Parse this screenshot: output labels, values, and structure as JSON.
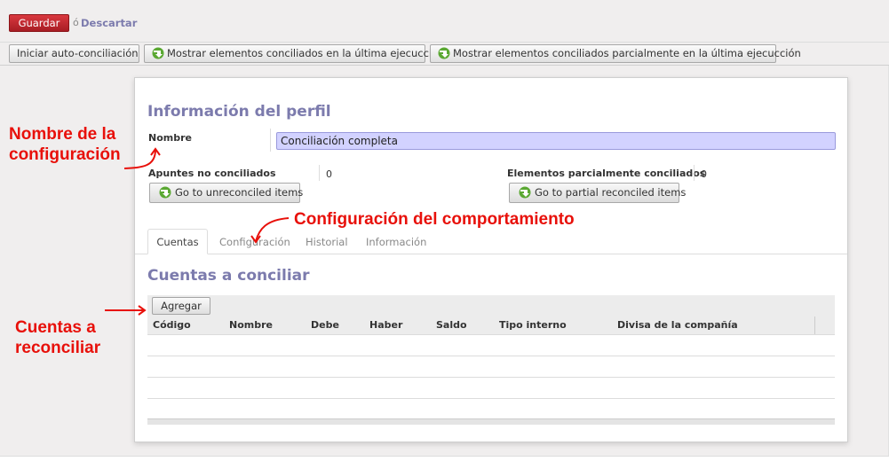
{
  "toolbar": {
    "save_label": "Guardar",
    "separator": "ó",
    "discard_label": "Descartar"
  },
  "action_buttons": {
    "auto_reconcile": "Iniciar auto-conciliación",
    "show_reconciled": "Mostrar elementos conciliados en la última ejecucción",
    "show_partial": "Mostrar elementos conciliados parcialmente en la última ejecucción"
  },
  "profile": {
    "title": "Información del perfil",
    "name_label": "Nombre",
    "name_value": "Conciliación completa",
    "unreconciled_label": "Apuntes no conciliados",
    "unreconciled_value": "0",
    "unreconciled_button": "Go to unreconciled items",
    "partial_label": "Elementos parcialmente conciliados",
    "partial_value": "0",
    "partial_button": "Go to partial reconciled items"
  },
  "tabs": [
    {
      "label": "Cuentas",
      "active": true
    },
    {
      "label": "Configuración",
      "active": false
    },
    {
      "label": "Historial",
      "active": false
    },
    {
      "label": "Información",
      "active": false
    }
  ],
  "accounts": {
    "title": "Cuentas a conciliar",
    "add_button": "Agregar",
    "columns": [
      "Código",
      "Nombre",
      "Debe",
      "Haber",
      "Saldo",
      "Tipo interno",
      "Divisa de la compañía"
    ]
  },
  "annotations": {
    "config_name": [
      "Nombre de la",
      "configuración"
    ],
    "behaviour": "Configuración del comportamiento",
    "accounts": [
      "Cuentas a",
      "reconciliar"
    ]
  },
  "colors": {
    "accent": "#7c7bad",
    "save": "#c62a31",
    "annotation": "#e8100a",
    "input_bg": "#d2d2ff"
  }
}
